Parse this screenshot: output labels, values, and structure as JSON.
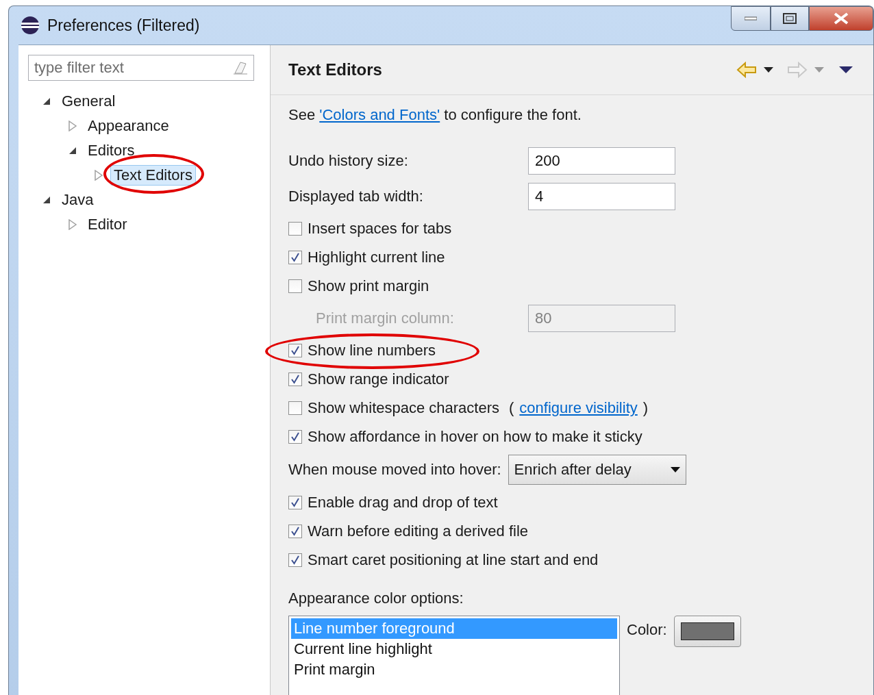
{
  "window": {
    "title": "Preferences (Filtered)"
  },
  "sidebar": {
    "filter": {
      "placeholder": "type filter text"
    },
    "tree": [
      {
        "label": "General",
        "expanded": true,
        "selected": false,
        "circled": false,
        "children": [
          {
            "label": "Appearance",
            "expanded": false,
            "selected": false,
            "circled": false
          },
          {
            "label": "Editors",
            "expanded": true,
            "selected": false,
            "circled": false,
            "children": [
              {
                "label": "Text Editors",
                "expanded": false,
                "selected": true,
                "circled": true
              }
            ]
          }
        ]
      },
      {
        "label": "Java",
        "expanded": true,
        "selected": false,
        "circled": false,
        "children": [
          {
            "label": "Editor",
            "expanded": false,
            "selected": false,
            "circled": false
          }
        ]
      }
    ]
  },
  "page": {
    "title": "Text Editors",
    "intro": {
      "before": "See ",
      "link": "'Colors and Fonts'",
      "after": " to configure the font."
    },
    "settings": [
      {
        "kind": "field",
        "label": "Undo history size:",
        "value": "200",
        "disabled": false
      },
      {
        "kind": "field",
        "label": "Displayed tab width:",
        "value": "4",
        "disabled": false
      },
      {
        "kind": "checkbox",
        "label": "Insert spaces for tabs",
        "checked": false,
        "circled": false
      },
      {
        "kind": "checkbox",
        "label": "Highlight current line",
        "checked": true,
        "circled": false
      },
      {
        "kind": "checkbox",
        "label": "Show print margin",
        "checked": false,
        "circled": false
      },
      {
        "kind": "field",
        "label": "Print margin column:",
        "value": "80",
        "disabled": true
      },
      {
        "kind": "checkbox",
        "label": "Show line numbers",
        "checked": true,
        "circled": true
      },
      {
        "kind": "checkbox",
        "label": "Show range indicator",
        "checked": true,
        "circled": false
      },
      {
        "kind": "checkbox",
        "label": "Show whitespace characters",
        "checked": false,
        "circled": false,
        "link_open": "(",
        "link": "configure visibility",
        "link_close": ")"
      },
      {
        "kind": "checkbox",
        "label": "Show affordance in hover on how to make it sticky",
        "checked": true,
        "circled": false
      },
      {
        "kind": "dropdown",
        "label": "When mouse moved into hover:",
        "value": "Enrich after delay"
      },
      {
        "kind": "checkbox",
        "label": "Enable drag and drop of text",
        "checked": true,
        "circled": false
      },
      {
        "kind": "checkbox",
        "label": "Warn before editing a derived file",
        "checked": true,
        "circled": false
      },
      {
        "kind": "checkbox",
        "label": "Smart caret positioning at line start and end",
        "checked": true,
        "circled": false
      }
    ],
    "color_options": {
      "label": "Appearance color options:",
      "items": [
        {
          "label": "Line number foreground",
          "selected": true
        },
        {
          "label": "Current line highlight",
          "selected": false
        },
        {
          "label": "Print margin",
          "selected": false
        }
      ],
      "color_label": "Color:",
      "color": "#707070"
    }
  }
}
